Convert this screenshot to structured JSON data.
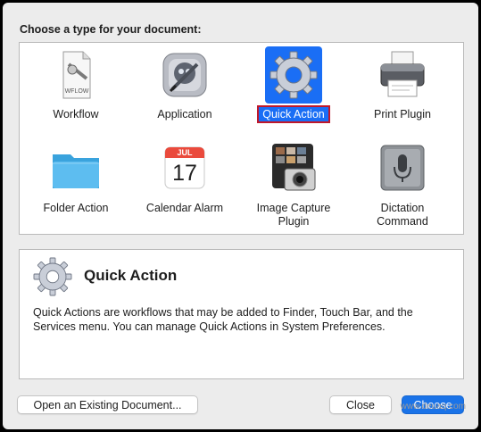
{
  "prompt": "Choose a type for your document:",
  "document_types": [
    {
      "label_line1": "Workflow",
      "label_line2": "",
      "icon": "workflow-document-icon",
      "selected": false
    },
    {
      "label_line1": "Application",
      "label_line2": "",
      "icon": "automator-robot-icon",
      "selected": false
    },
    {
      "label_line1": "Quick Action",
      "label_line2": "",
      "icon": "gear-icon",
      "selected": true
    },
    {
      "label_line1": "Print Plugin",
      "label_line2": "",
      "icon": "printer-icon",
      "selected": false
    },
    {
      "label_line1": "Folder Action",
      "label_line2": "",
      "icon": "folder-icon",
      "selected": false
    },
    {
      "label_line1": "Calendar Alarm",
      "label_line2": "",
      "icon": "calendar-icon",
      "selected": false,
      "calendar_month": "JUL",
      "calendar_day": "17"
    },
    {
      "label_line1": "Image Capture",
      "label_line2": "Plugin",
      "icon": "camera-photos-icon",
      "selected": false
    },
    {
      "label_line1": "Dictation",
      "label_line2": "Command",
      "icon": "microphone-icon",
      "selected": false
    }
  ],
  "workflow_icon_text": "WFLOW",
  "description": {
    "title": "Quick Action",
    "text": "Quick Actions are workflows that may be added to Finder, Touch Bar, and the Services menu. You can manage Quick Actions in System Preferences."
  },
  "buttons": {
    "open_existing": "Open an Existing Document...",
    "close": "Close",
    "choose": "Choose"
  },
  "watermark": "www.deuaq.com",
  "colors": {
    "selection": "#1a6ef5",
    "selection_outline": "#c0172a",
    "primary_button": "#1a73e8"
  }
}
